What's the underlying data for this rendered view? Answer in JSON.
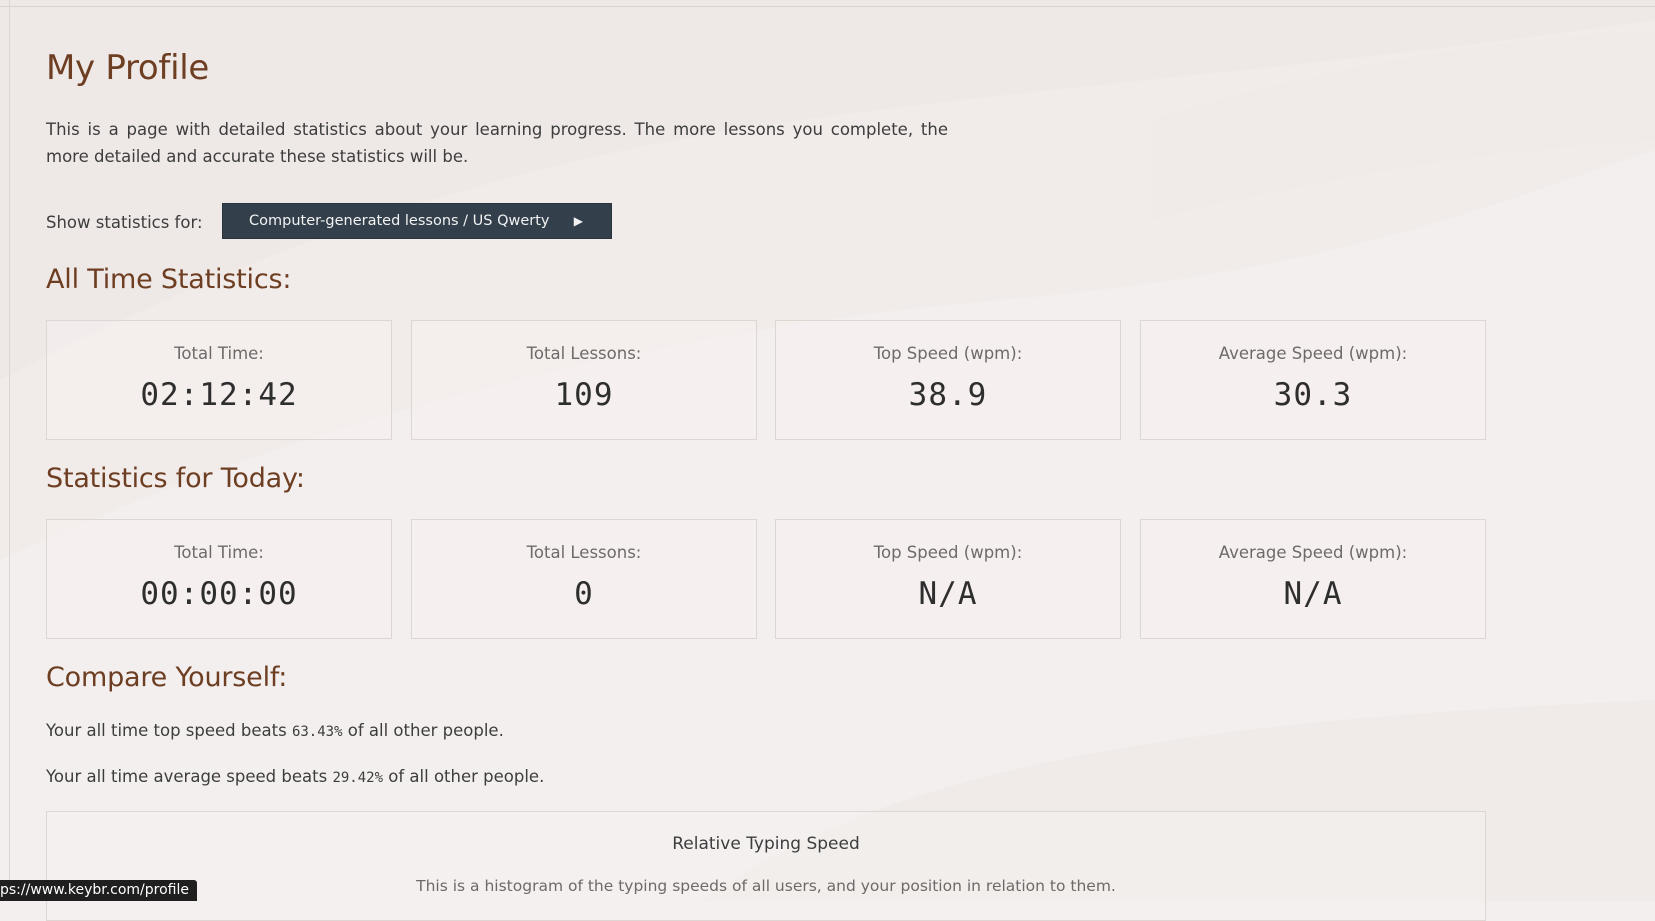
{
  "page": {
    "title": "My Profile",
    "intro": "This is a page with detailed statistics about your learning progress. The more lessons you complete, the more detailed and accurate these statistics will be."
  },
  "selector": {
    "label": "Show statistics for:",
    "value": "Computer-generated lessons / US Qwerty",
    "arrow_icon": "triangle-right-icon"
  },
  "all_time": {
    "heading": "All Time Statistics:",
    "cards": [
      {
        "label": "Total Time:",
        "value": "02:12:42"
      },
      {
        "label": "Total Lessons:",
        "value": "109"
      },
      {
        "label": "Top Speed (wpm):",
        "value": "38.9"
      },
      {
        "label": "Average Speed (wpm):",
        "value": "30.3"
      }
    ]
  },
  "today": {
    "heading": "Statistics for Today:",
    "cards": [
      {
        "label": "Total Time:",
        "value": "00:00:00"
      },
      {
        "label": "Total Lessons:",
        "value": "0"
      },
      {
        "label": "Top Speed (wpm):",
        "value": "N/A"
      },
      {
        "label": "Average Speed (wpm):",
        "value": "N/A"
      }
    ]
  },
  "compare": {
    "heading": "Compare Yourself:",
    "top_speed": {
      "prefix": "Your all time top speed beats ",
      "percent": "63.43%",
      "suffix": " of all other people."
    },
    "avg_speed": {
      "prefix": "Your all time average speed beats ",
      "percent": "29.42%",
      "suffix": " of all other people."
    }
  },
  "chart": {
    "title": "Relative Typing Speed",
    "description": "This is a histogram of the typing speeds of all users, and your position in relation to them."
  },
  "status_bar": {
    "url": "ps://www.keybr.com/profile"
  },
  "colors": {
    "heading": "#6d3e22",
    "button_bg": "#33404b",
    "page_bg": "#f3efee"
  }
}
